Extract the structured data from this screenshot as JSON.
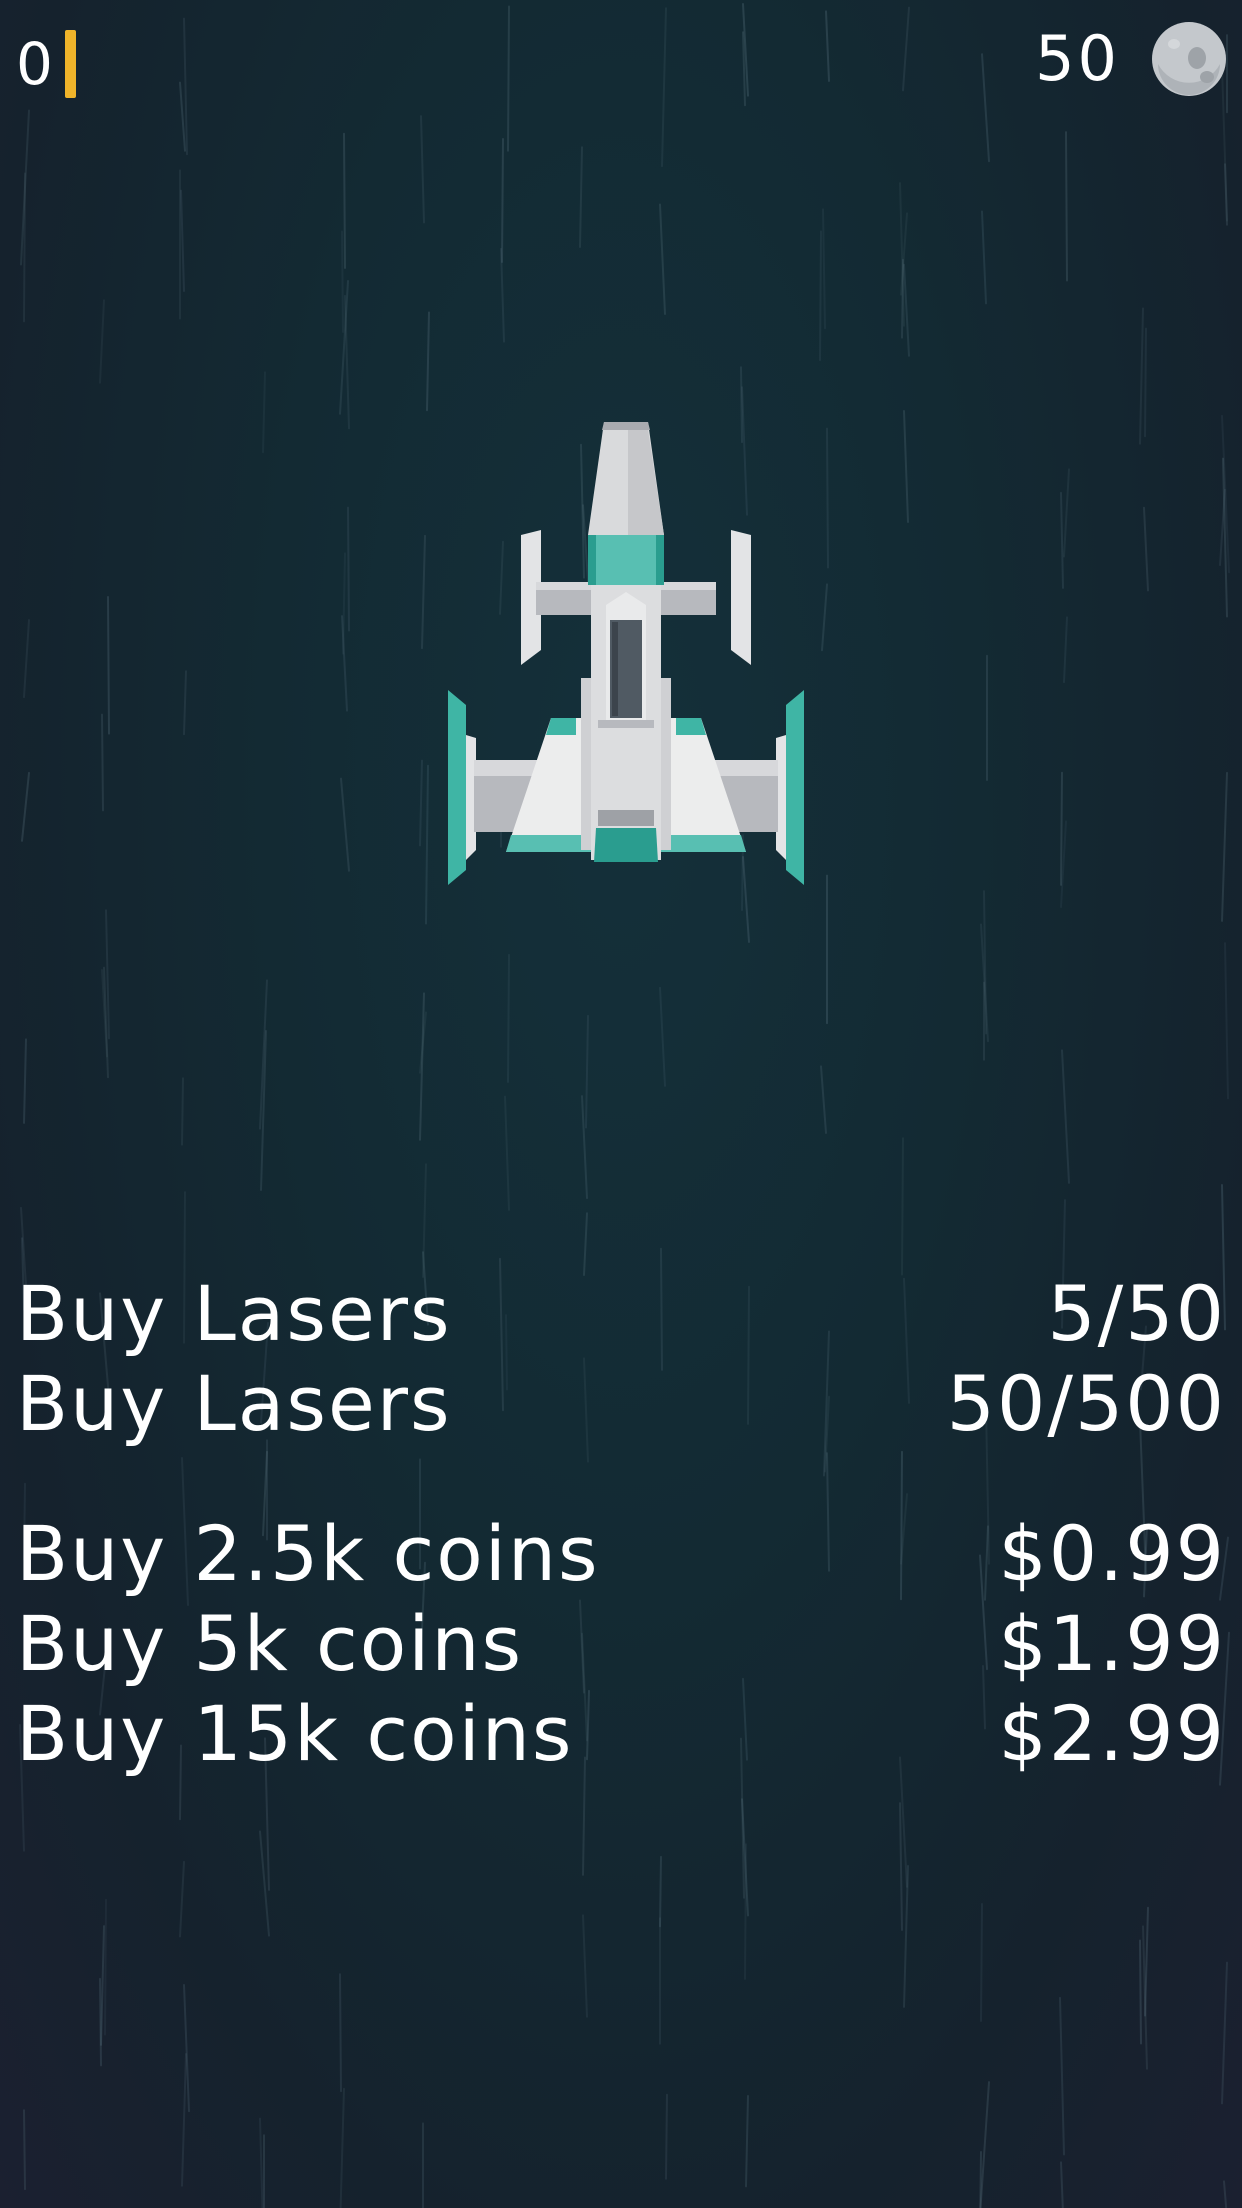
{
  "hud": {
    "lasers": "0",
    "coins": "50",
    "coin_icon": "asteroid-coin-icon",
    "laser_bar_color": "#f0b42a"
  },
  "player": {
    "ship_icon": "spaceship-icon"
  },
  "store": {
    "laser_offers": [
      {
        "label": "Buy Lasers",
        "price": "5/50"
      },
      {
        "label": "Buy Lasers",
        "price": "50/500"
      }
    ],
    "coin_offers": [
      {
        "label": "Buy 2.5k coins",
        "price": "$0.99"
      },
      {
        "label": "Buy 5k coins",
        "price": "$1.99"
      },
      {
        "label": "Buy 15k coins",
        "price": "$2.99"
      }
    ]
  },
  "colors": {
    "background": "#132a33",
    "accent": "#3fb5a5",
    "text": "#ffffff"
  }
}
